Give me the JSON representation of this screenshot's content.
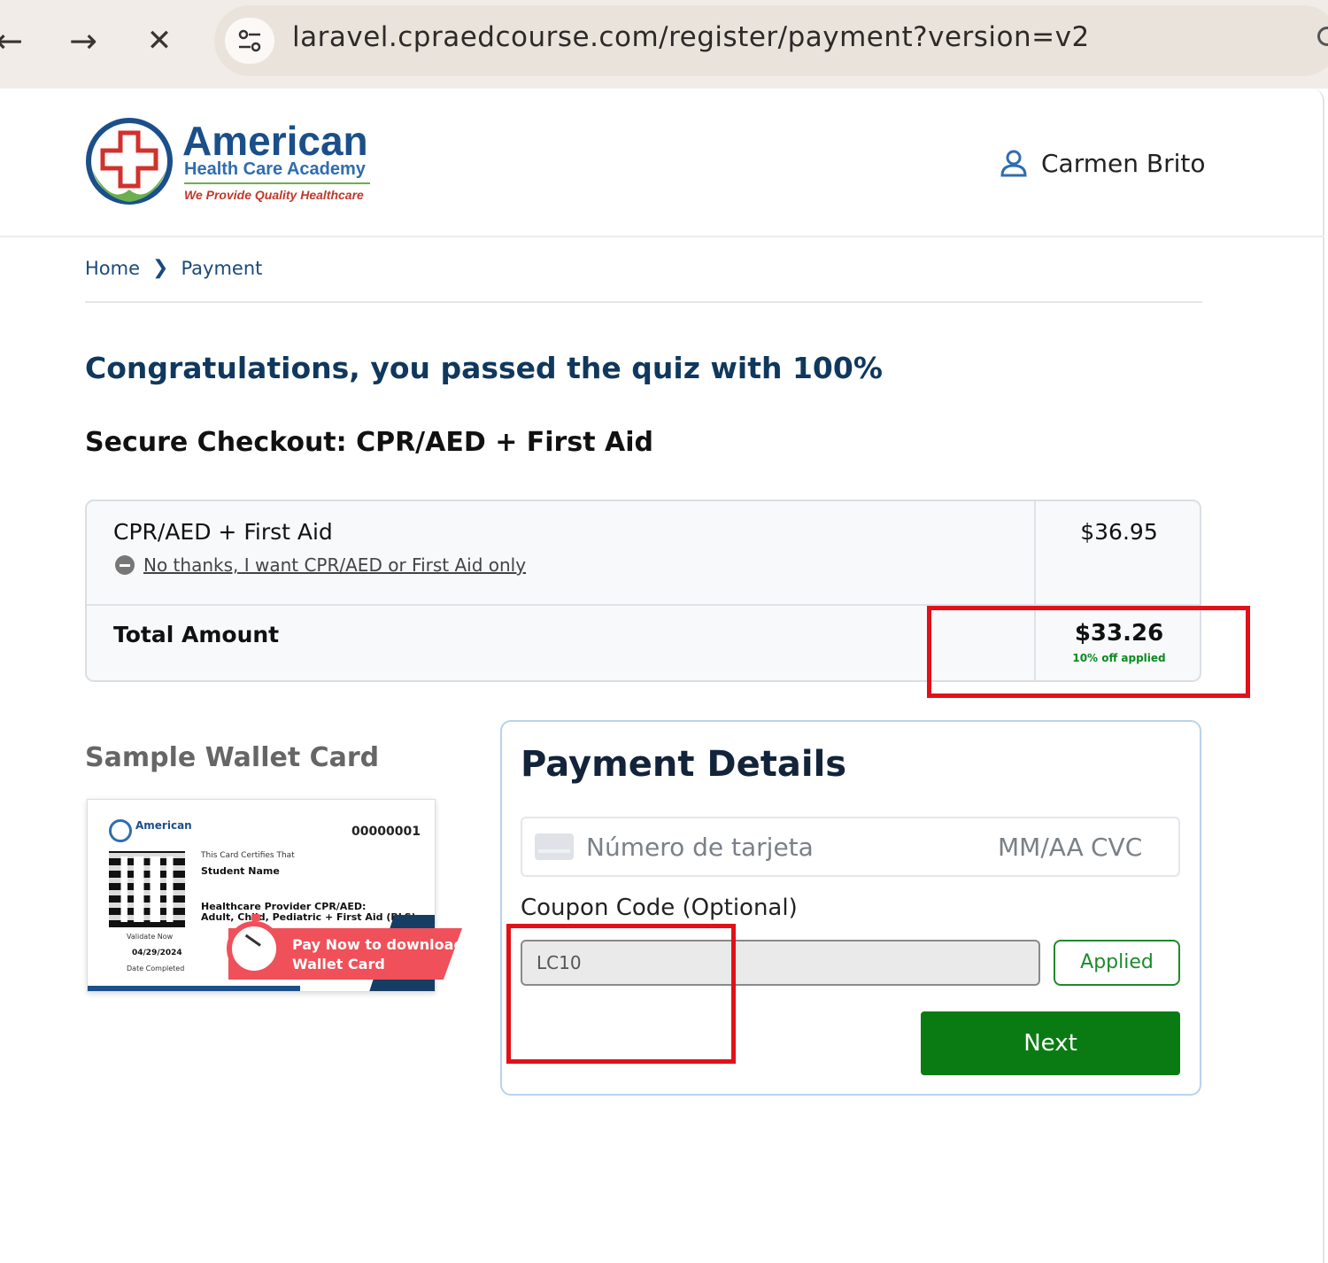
{
  "browser": {
    "url": "laravel.cpraedcourse.com/register/payment?version=v2",
    "back_icon": "arrow-left-icon",
    "forward_icon": "arrow-right-icon",
    "stop_icon": "close-icon"
  },
  "header": {
    "logo": {
      "title": "American",
      "subtitle": "Health Care Academy",
      "tagline": "We Provide Quality Healthcare"
    },
    "user_name": "Carmen Brito"
  },
  "breadcrumb": {
    "home": "Home",
    "current": "Payment"
  },
  "main": {
    "congrats": "Congratulations, you passed the quiz with 100%",
    "checkout_title": "Secure Checkout: CPR/AED + First Aid"
  },
  "order": {
    "item_name": "CPR/AED + First Aid",
    "item_price": "$36.95",
    "remove_link": "No thanks, I want CPR/AED or First Aid only",
    "total_label": "Total Amount",
    "total_value": "$33.26",
    "discount_note": "10% off applied"
  },
  "wallet": {
    "title": "Sample Wallet Card",
    "brand": "American",
    "card_number": "00000001",
    "line1": "This Card Certifies That",
    "student": "Student Name",
    "course": "Healthcare Provider CPR/AED:",
    "course2": "Adult, Child, Pediatric + First Aid (BLS)",
    "valid": "Validate Now",
    "date": "04/29/2024",
    "completed": "Date Completed",
    "promo": "Pay Now to download",
    "promo2": "Wallet Card"
  },
  "payment": {
    "title": "Payment Details",
    "card_placeholder": "Número de tarjeta",
    "exp_placeholder": "MM/AA",
    "cvc_placeholder": "CVC",
    "coupon_label": "Coupon Code (Optional)",
    "coupon_value": "LC10",
    "applied_label": "Applied",
    "next_label": "Next"
  },
  "colors": {
    "brand_navy": "#10385e",
    "success_green": "#097b12",
    "annotation_red": "#e3101a",
    "browser_chrome": "#f1ece7"
  }
}
